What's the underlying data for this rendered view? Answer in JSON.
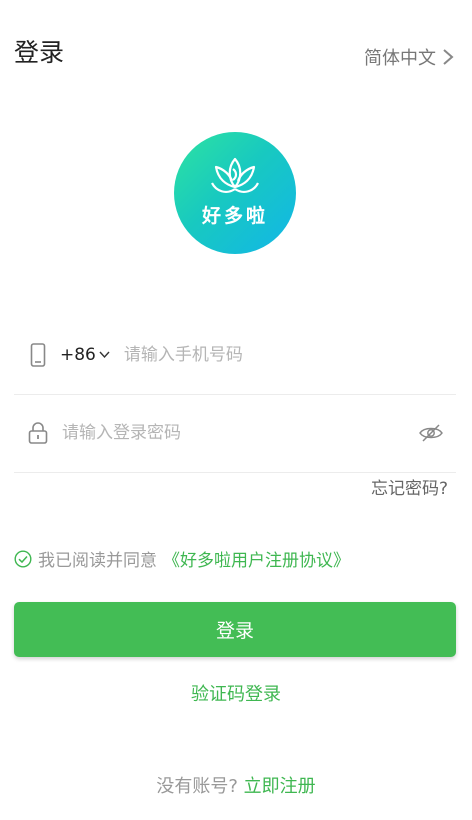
{
  "header": {
    "title": "登录",
    "language": "简体中文"
  },
  "logo": {
    "text": "好多啦"
  },
  "phone": {
    "country_code": "+86",
    "placeholder": "请输入手机号码",
    "value": ""
  },
  "password": {
    "placeholder": "请输入登录密码",
    "value": ""
  },
  "forgot_password": "忘记密码?",
  "agreement": {
    "checked": true,
    "prefix": "我已阅读并同意",
    "link": "《好多啦用户注册协议》"
  },
  "login_button": "登录",
  "sms_login": "验证码登录",
  "register": {
    "question": "没有账号?",
    "link": "立即注册"
  },
  "colors": {
    "accent": "#43bd55",
    "link": "#3fb751",
    "logo_start": "#2ee3a0",
    "logo_end": "#12b6e8"
  },
  "icons": [
    "chevron-right-icon",
    "lotus-logo-icon",
    "phone-icon",
    "chevron-down-icon",
    "lock-icon",
    "eye-off-icon",
    "check-circle-icon"
  ]
}
